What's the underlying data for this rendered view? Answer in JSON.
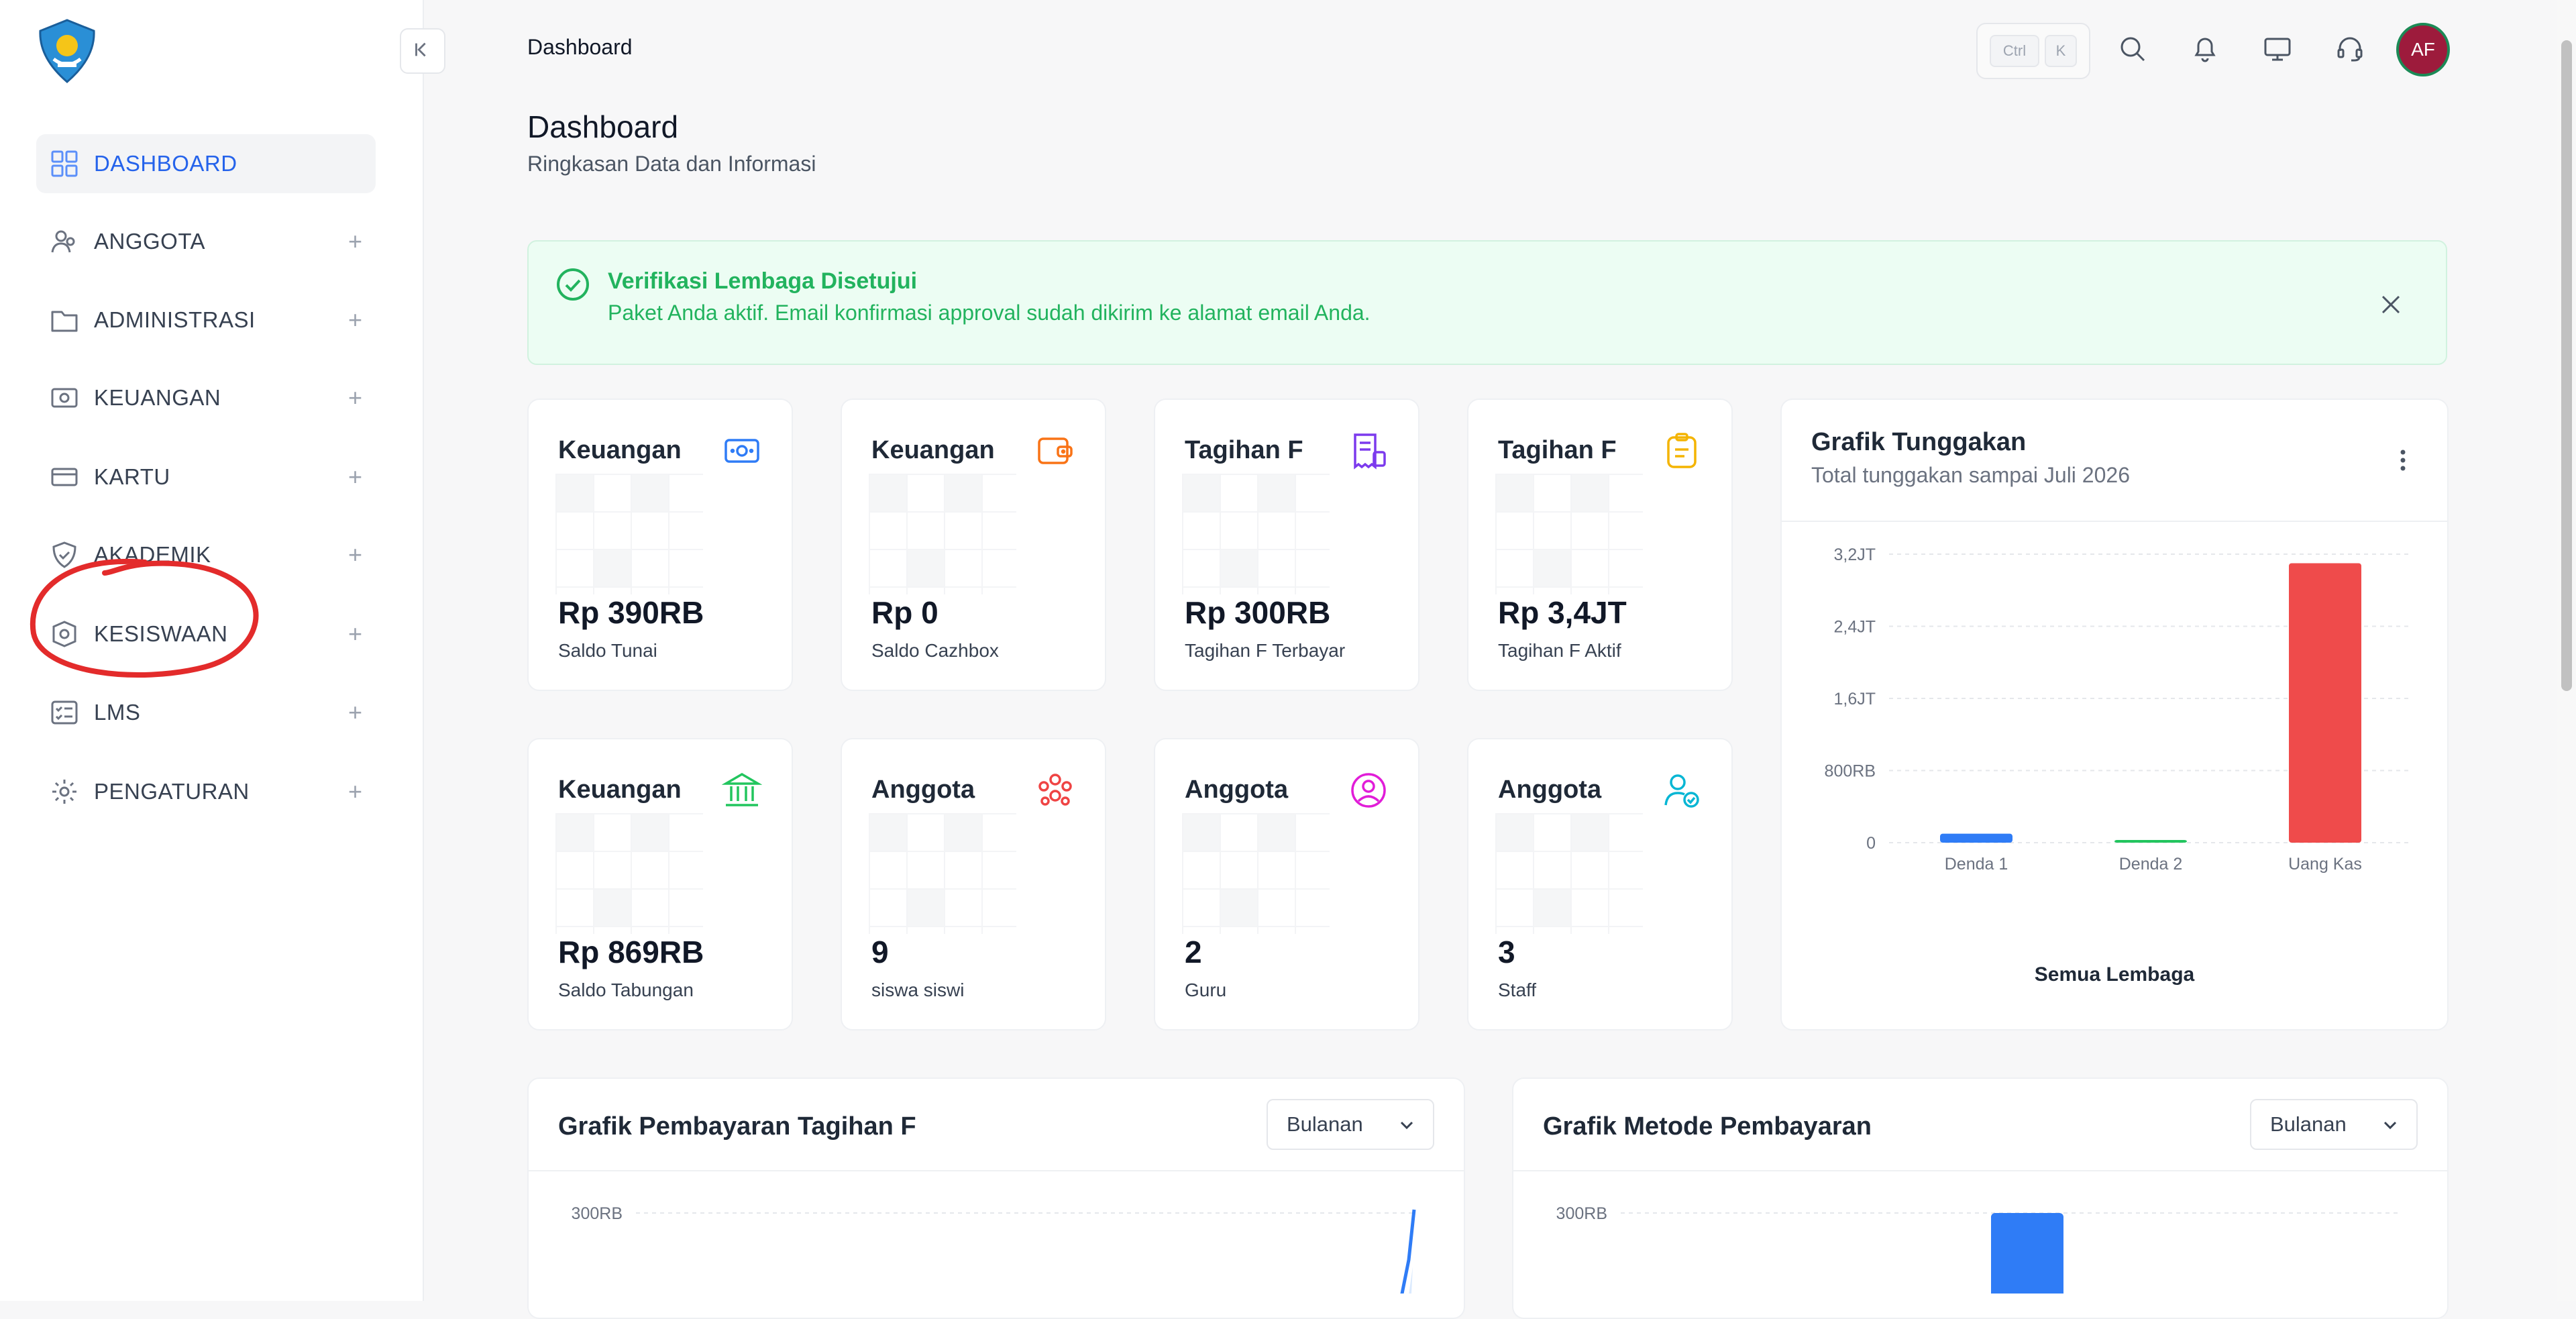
{
  "header": {
    "title": "Dashboard",
    "shortcut": {
      "key1": "Ctrl",
      "key2": "K"
    },
    "avatar_initials": "AF"
  },
  "sidebar": {
    "items": [
      {
        "label": "DASHBOARD",
        "icon": "dashboard-grid-icon",
        "active": true
      },
      {
        "label": "ANGGOTA",
        "icon": "users-icon",
        "expand": "+"
      },
      {
        "label": "ADMINISTRASI",
        "icon": "folder-icon",
        "expand": "+"
      },
      {
        "label": "KEUANGAN",
        "icon": "money-icon",
        "expand": "+"
      },
      {
        "label": "KARTU",
        "icon": "card-icon",
        "expand": "+"
      },
      {
        "label": "AKADEMIK",
        "icon": "shield-icon",
        "expand": "+"
      },
      {
        "label": "KESISWAAN",
        "icon": "student-badge-icon",
        "expand": "+"
      },
      {
        "label": "LMS",
        "icon": "checklist-icon",
        "expand": "+"
      },
      {
        "label": "PENGATURAN",
        "icon": "gear-icon",
        "expand": "+"
      }
    ]
  },
  "page": {
    "title": "Dashboard",
    "subtitle": "Ringkasan Data dan Informasi"
  },
  "alert": {
    "title": "Verifikasi Lembaga Disetujui",
    "message": "Paket Anda aktif. Email konfirmasi approval sudah dikirim ke alamat email Anda."
  },
  "stats": [
    {
      "title": "Keuangan",
      "value": "Rp 390RB",
      "label": "Saldo Tunai",
      "icon": "cash-icon",
      "color": "#2f7cf6"
    },
    {
      "title": "Keuangan",
      "value": "Rp 0",
      "label": "Saldo Cazhbox",
      "icon": "wallet-icon",
      "color": "#f97316"
    },
    {
      "title": "Tagihan F",
      "value": "Rp 300RB",
      "label": "Tagihan F Terbayar",
      "icon": "invoice-icon",
      "color": "#7c3aed"
    },
    {
      "title": "Tagihan F",
      "value": "Rp 3,4JT",
      "label": "Tagihan F Aktif",
      "icon": "clipboard-icon",
      "color": "#f4b400"
    },
    {
      "title": "Keuangan",
      "value": "Rp 869RB",
      "label": "Saldo Tabungan",
      "icon": "bank-icon",
      "color": "#22c55e"
    },
    {
      "title": "Anggota",
      "value": "9",
      "label": "siswa siswi",
      "icon": "group-icon",
      "color": "#ef4444"
    },
    {
      "title": "Anggota",
      "value": "2",
      "label": "Guru",
      "icon": "user-circle-icon",
      "color": "#e11dd8"
    },
    {
      "title": "Anggota",
      "value": "3",
      "label": "Staff",
      "icon": "user-check-icon",
      "color": "#06b6d4"
    }
  ],
  "tunggakan": {
    "title": "Grafik Tunggakan",
    "subtitle": "Total tunggakan sampai Juli 2026",
    "footer": "Semua Lembaga"
  },
  "pembayaran": {
    "title": "Grafik Pembayaran Tagihan F",
    "period": "Bulanan"
  },
  "metode": {
    "title": "Grafik Metode Pembayaran",
    "period": "Bulanan"
  },
  "colors": {
    "accent": "#2563eb",
    "success": "#22b35e",
    "danger": "#ef4b4b"
  },
  "chart_data": [
    {
      "type": "bar",
      "title": "Grafik Tunggakan",
      "categories": [
        "Denda 1",
        "Denda 2",
        "Uang Kas"
      ],
      "values": [
        100000,
        20000,
        3100000
      ],
      "bar_colors": [
        "#2f7cf6",
        "#22c55e",
        "#ef4b4b"
      ],
      "ylim": [
        0,
        3200000
      ],
      "ytick_labels": [
        "0",
        "800RB",
        "1,6JT",
        "2,4JT",
        "3,2JT"
      ],
      "ytick_values": [
        0,
        800000,
        1600000,
        2400000,
        3200000
      ],
      "xlabel": "Semua Lembaga",
      "grid": true
    },
    {
      "type": "line",
      "title": "Grafik Pembayaran Tagihan F",
      "ytick_labels": [
        "300RB"
      ],
      "ytick_values": [
        300000
      ],
      "grid": true
    },
    {
      "type": "bar",
      "title": "Grafik Metode Pembayaran",
      "ytick_labels": [
        "300RB"
      ],
      "ytick_values": [
        300000
      ],
      "grid": true
    }
  ]
}
